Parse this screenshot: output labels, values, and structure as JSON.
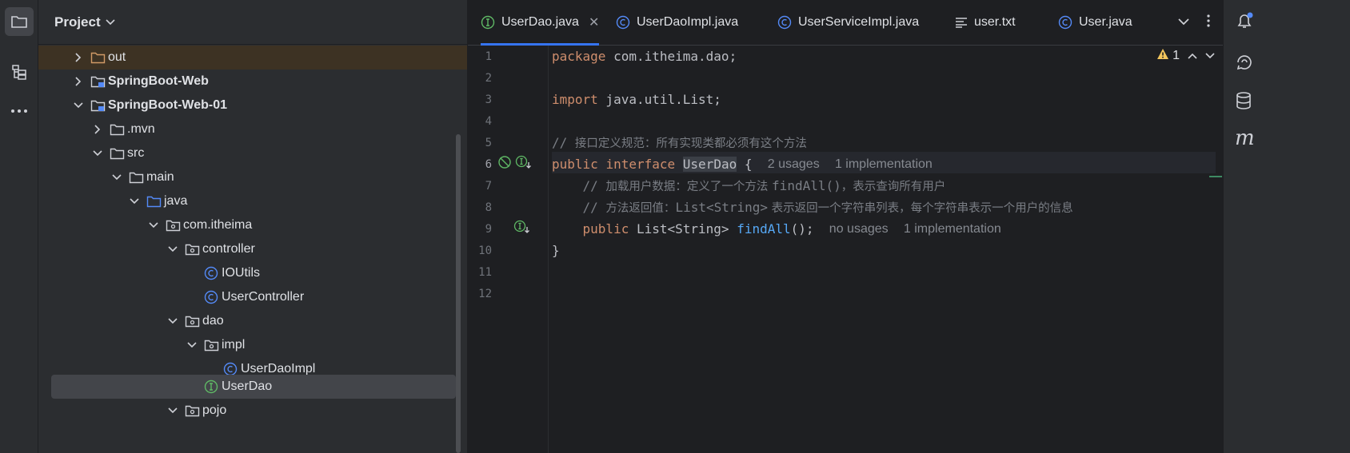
{
  "sidebar": {
    "project_label": "Project",
    "tree": [
      {
        "label": "out",
        "bold": false
      },
      {
        "label": "SpringBoot-Web",
        "bold": true
      },
      {
        "label": "SpringBoot-Web-01",
        "bold": true
      },
      {
        "label": ".mvn",
        "bold": false
      },
      {
        "label": "src",
        "bold": false
      },
      {
        "label": "main",
        "bold": false
      },
      {
        "label": "java",
        "bold": false
      },
      {
        "label": "com.itheima",
        "bold": false
      },
      {
        "label": "controller",
        "bold": false
      },
      {
        "label": "IOUtils",
        "bold": false
      },
      {
        "label": "UserController",
        "bold": false
      },
      {
        "label": "dao",
        "bold": false
      },
      {
        "label": "impl",
        "bold": false
      },
      {
        "label": "UserDaoImpl",
        "bold": false
      },
      {
        "label": "UserDao",
        "bold": false
      },
      {
        "label": "pojo",
        "bold": false
      }
    ]
  },
  "tabs": [
    {
      "label": "UserDao.java",
      "icon": "interface-icon"
    },
    {
      "label": "UserDaoImpl.java",
      "icon": "class-icon"
    },
    {
      "label": "UserServiceImpl.java",
      "icon": "class-icon"
    },
    {
      "label": "user.txt",
      "icon": "text-file-icon"
    },
    {
      "label": "User.java",
      "icon": "class-icon"
    }
  ],
  "editor": {
    "line_numbers": [
      "1",
      "2",
      "3",
      "4",
      "5",
      "6",
      "7",
      "8",
      "9",
      "10",
      "11",
      "12"
    ],
    "inspection_count": "1",
    "line1": {
      "kw": "package",
      "rest": " com.itheima.dao;"
    },
    "line3": {
      "kw": "import",
      "rest": " java.util.List;"
    },
    "line5": {
      "slashes": "// ",
      "text": "接口定义规范：所有实现类都必须有这个方法"
    },
    "line6": {
      "kw1": "public",
      "kw2": "interface",
      "name": "UserDao",
      "brace": " {",
      "hint1": "2 usages",
      "hint2": "1 implementation"
    },
    "line7": {
      "slashes": "// ",
      "text1": "加载用户数据：定义了一个方法 ",
      "code": "findAll()",
      "text2": "，表示查询所有用户"
    },
    "line8": {
      "slashes": "// ",
      "text1": "方法返回值：",
      "code": "List<String>",
      "text2": " 表示返回一个字符串列表，每个字符串表示一个用户的信息"
    },
    "line9": {
      "kw": "public",
      "type": " List<String> ",
      "fn": "findAll",
      "rest": "();",
      "hint1": "no usages",
      "hint2": "1 implementation"
    },
    "line10": "}"
  },
  "right_toolbar": {
    "m_label": "m"
  }
}
